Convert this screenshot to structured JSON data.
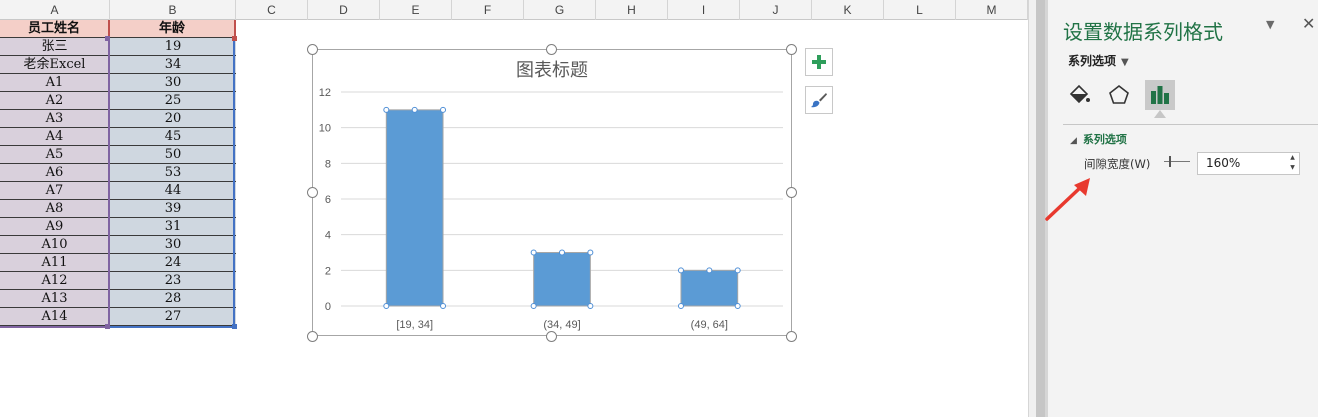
{
  "columns": [
    "A",
    "B",
    "C",
    "D",
    "E",
    "F",
    "G",
    "H",
    "I",
    "J",
    "K",
    "L",
    "M"
  ],
  "table": {
    "headers": [
      "员工姓名",
      "年龄"
    ],
    "rows": [
      [
        "张三",
        "19"
      ],
      [
        "老余Excel",
        "34"
      ],
      [
        "A1",
        "30"
      ],
      [
        "A2",
        "25"
      ],
      [
        "A3",
        "20"
      ],
      [
        "A4",
        "45"
      ],
      [
        "A5",
        "50"
      ],
      [
        "A6",
        "53"
      ],
      [
        "A7",
        "44"
      ],
      [
        "A8",
        "39"
      ],
      [
        "A9",
        "31"
      ],
      [
        "A10",
        "30"
      ],
      [
        "A11",
        "24"
      ],
      [
        "A12",
        "23"
      ],
      [
        "A13",
        "28"
      ],
      [
        "A14",
        "27"
      ]
    ]
  },
  "chart_data": {
    "type": "bar",
    "title": "图表标题",
    "categories": [
      "[19, 34]",
      "(34, 49]",
      "(49, 64]"
    ],
    "values": [
      11,
      3,
      2
    ],
    "ylim": [
      0,
      12
    ],
    "yticks": [
      0,
      2,
      4,
      6,
      8,
      10,
      12
    ],
    "xlabel": "",
    "ylabel": "",
    "grid": true,
    "bar_color": "#5b9bd5",
    "selected": true
  },
  "chart_buttons": {
    "add_element_icon": "plus-icon",
    "style_icon": "brush-icon"
  },
  "format_pane": {
    "title": "设置数据系列格式",
    "menu_icon": "▼",
    "close_icon": "✕",
    "options_dropdown": "系列选项",
    "tabs": [
      "fill-line-icon",
      "effects-icon",
      "series-options-icon"
    ],
    "section_title": "系列选项",
    "gap_width_label": "间隙宽度(W)",
    "gap_width_value": "160%",
    "accent_color": "#217346"
  },
  "annotation": {
    "arrow_color": "#e8392e"
  }
}
